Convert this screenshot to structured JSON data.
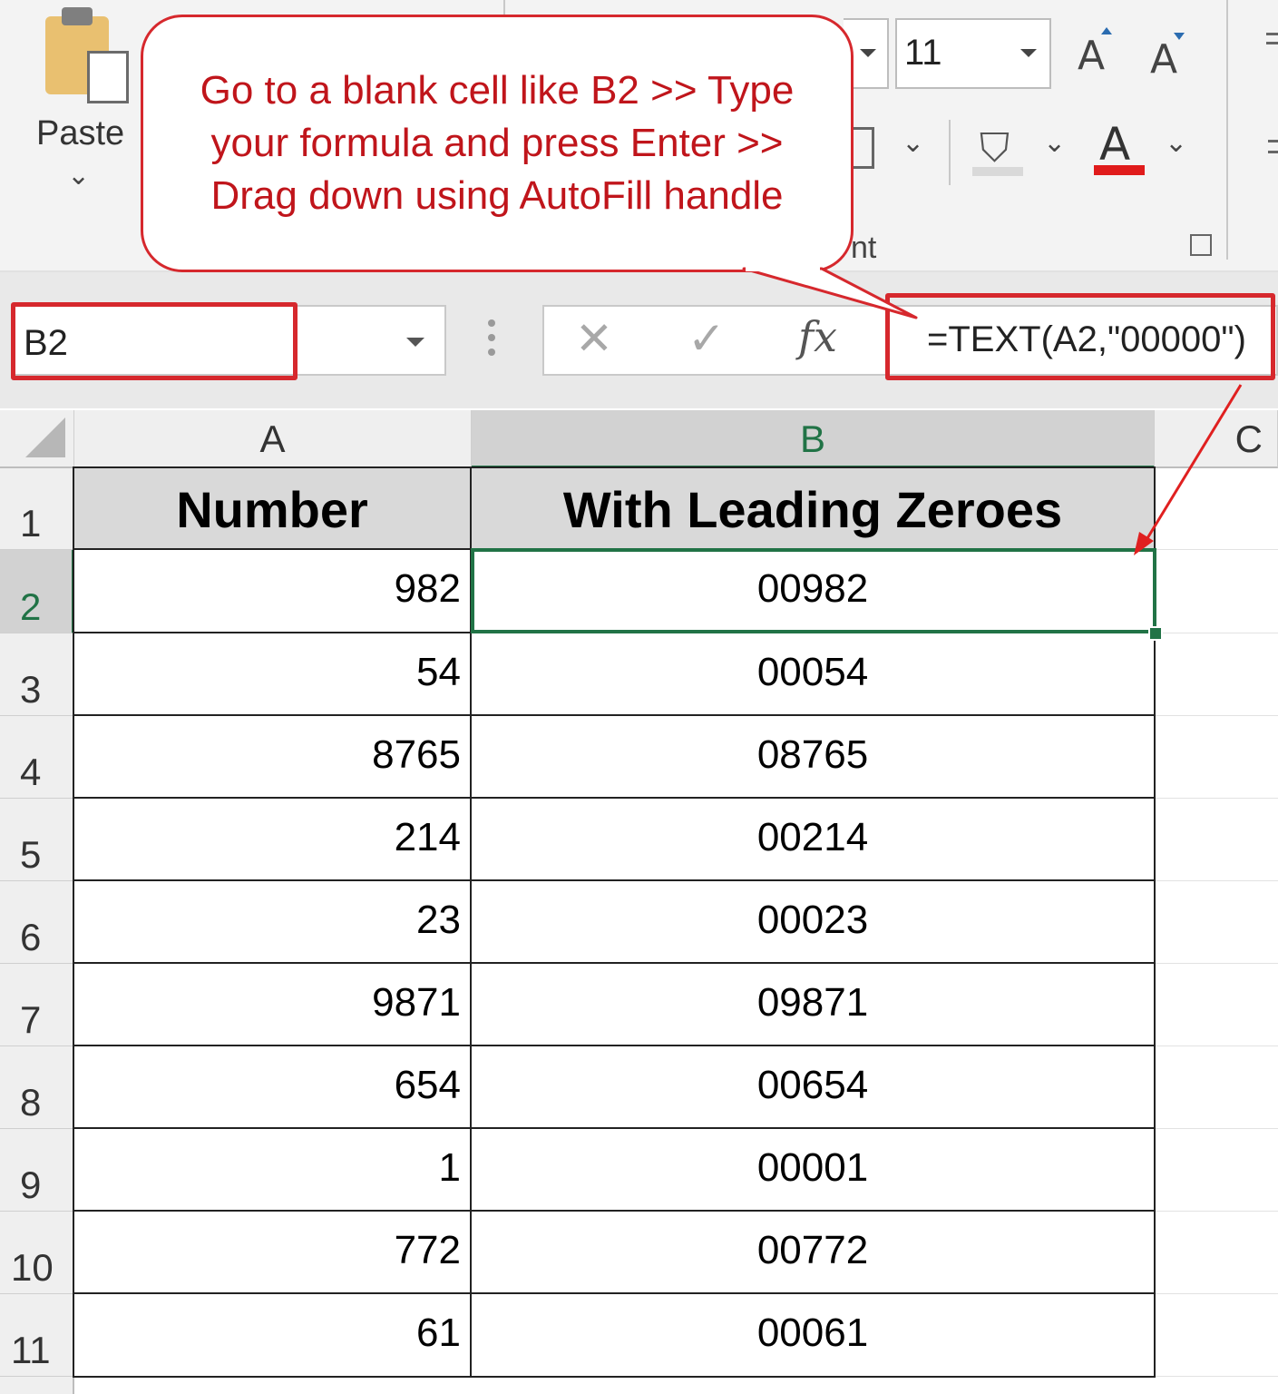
{
  "ribbon": {
    "paste_label": "Paste",
    "font_size": "11",
    "grow_font_label": "A",
    "shrink_font_label": "A",
    "font_color_label": "A",
    "group_label_fragment": "nt",
    "font_color_bar": "#e01b1b"
  },
  "callout": {
    "lines": [
      "Go to a blank cell like B2 >> Type",
      "your formula and press Enter >>",
      "Drag down using AutoFill handle"
    ],
    "color": "#c0151b"
  },
  "formula_bar": {
    "name_box": "B2",
    "cancel_icon": "✕",
    "enter_icon": "✓",
    "fx_label": "fx",
    "formula": "=TEXT(A2,\"00000\")"
  },
  "grid": {
    "columns": [
      "A",
      "B",
      "C"
    ],
    "headers": [
      "Number",
      "With Leading Zeroes"
    ],
    "row_numbers": [
      "1",
      "2",
      "3",
      "4",
      "5",
      "6",
      "7",
      "8",
      "9",
      "10",
      "11"
    ],
    "rows": [
      {
        "number": "982",
        "padded": "00982"
      },
      {
        "number": "54",
        "padded": "00054"
      },
      {
        "number": "8765",
        "padded": "08765"
      },
      {
        "number": "214",
        "padded": "00214"
      },
      {
        "number": "23",
        "padded": "00023"
      },
      {
        "number": "9871",
        "padded": "09871"
      },
      {
        "number": "654",
        "padded": "00654"
      },
      {
        "number": "1",
        "padded": "00001"
      },
      {
        "number": "772",
        "padded": "00772"
      },
      {
        "number": "61",
        "padded": "00061"
      }
    ],
    "selected_cell": "B2",
    "accent": "#217346",
    "highlight": "#d6282d"
  }
}
